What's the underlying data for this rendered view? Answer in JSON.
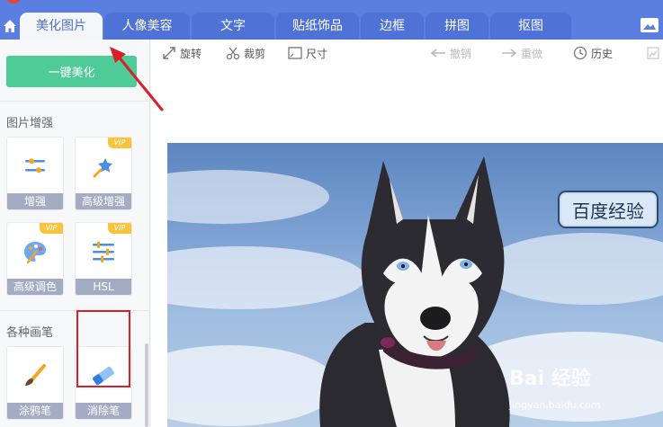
{
  "tabs": [
    {
      "label": "美化图片",
      "active": true
    },
    {
      "label": "人像美容",
      "active": false
    },
    {
      "label": "文字",
      "active": false
    },
    {
      "label": "贴纸饰品",
      "active": false
    },
    {
      "label": "边框",
      "active": false
    },
    {
      "label": "拼图",
      "active": false
    },
    {
      "label": "抠图",
      "active": false
    }
  ],
  "sidebar": {
    "one_click_label": "一键美化",
    "section_enhance": "图片增强",
    "section_brushes": "各种画笔",
    "enhance_tools": [
      {
        "label": "增强",
        "vip": false,
        "icon": "sliders-icon"
      },
      {
        "label": "高级增强",
        "vip": true,
        "icon": "magic-wand-icon"
      },
      {
        "label": "高级调色",
        "vip": true,
        "icon": "palette-icon"
      },
      {
        "label": "HSL",
        "vip": true,
        "icon": "hsl-sliders-icon"
      }
    ],
    "brush_tools": [
      {
        "label": "涂鸦笔",
        "vip": false,
        "icon": "brush-icon"
      },
      {
        "label": "消除笔",
        "vip": false,
        "icon": "eraser-icon"
      }
    ],
    "vip_label": "VIP"
  },
  "toolbar": {
    "rotate": "旋转",
    "crop": "裁剪",
    "size": "尺寸",
    "undo": "撤销",
    "redo": "重做",
    "history": "历史"
  },
  "canvas": {
    "badge_text": "百度经验",
    "watermark": "Bai 经验",
    "watermark_url": "jingyan.baidu.com"
  },
  "colors": {
    "topbar": "#5a7fe0",
    "accent_green": "#4ecb96",
    "vip_yellow": "#f8c43b",
    "annotation_red": "#d9202a"
  }
}
